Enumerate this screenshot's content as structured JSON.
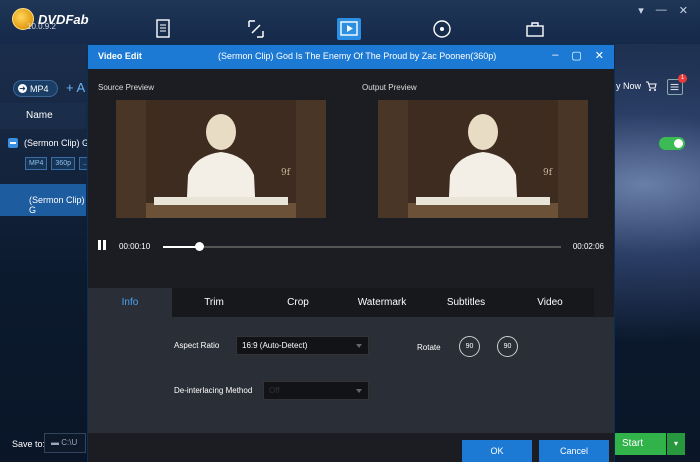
{
  "app": {
    "logo_text": "DVDFab",
    "version": "10.0.9.2"
  },
  "toolbar": {
    "profile_label": "MP4",
    "add_label": "+ A"
  },
  "list": {
    "header": "Name",
    "row1_title": "(Sermon Clip) G",
    "tags": [
      "MP4",
      "360p",
      "..."
    ],
    "row2_title": "(Sermon Clip) G"
  },
  "bottom": {
    "save_to_label": "Save to:",
    "save_path": "C:\\U",
    "start_label": "Start"
  },
  "right": {
    "buy_now": "y Now",
    "badge_count": "1"
  },
  "dialog": {
    "title": "Video Edit",
    "file_title": "(Sermon Clip) God Is The Enemy Of The Proud by Zac Poonen(360p)",
    "source_label": "Source Preview",
    "output_label": "Output Preview",
    "time_current": "00:00:10",
    "time_total": "00:02:06",
    "progress": 0.09,
    "tabs": [
      "Info",
      "Trim",
      "Crop",
      "Watermark",
      "Subtitles",
      "Video"
    ],
    "active_tab": "Info",
    "aspect_ratio_label": "Aspect Ratio",
    "aspect_ratio_value": "16:9 (Auto-Detect)",
    "deinterlace_label": "De-interlacing Method",
    "deinterlace_value": "Off",
    "rotate_label": "Rotate",
    "rotate_left": "90",
    "rotate_right": "90",
    "ok_label": "OK",
    "cancel_label": "Cancel"
  },
  "colors": {
    "accent": "#1c7ad4",
    "start": "#31b34a"
  }
}
